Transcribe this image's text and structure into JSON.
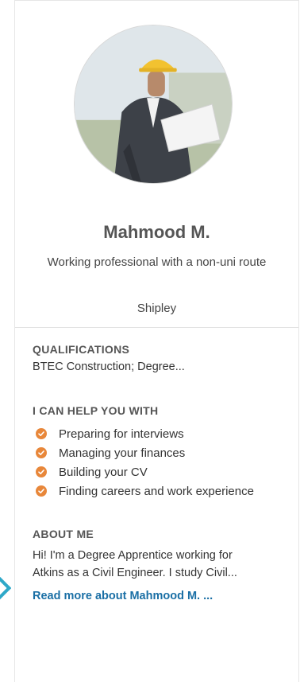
{
  "profile": {
    "name": "Mahmood M.",
    "tagline": "Working professional with a non-uni route",
    "location": "Shipley"
  },
  "qualifications": {
    "title": "QUALIFICATIONS",
    "text": "BTEC Construction; Degree..."
  },
  "help": {
    "title": "I CAN HELP YOU WITH",
    "items": [
      {
        "label": "Preparing for interviews",
        "icon": "check-icon"
      },
      {
        "label": "Managing your finances",
        "icon": "check-icon"
      },
      {
        "label": "Building your CV",
        "icon": "check-icon"
      },
      {
        "label": "Finding careers and work experience",
        "icon": "check-icon"
      }
    ]
  },
  "about": {
    "title": "ABOUT ME",
    "line1": "Hi! I'm a Degree Apprentice working for",
    "line2": "Atkins as a Civil Engineer. I study Civil..."
  },
  "read_more_label": "Read more about Mahmood M. ...",
  "colors": {
    "accent_orange": "#e8873a",
    "link_blue": "#1a6fa5",
    "left_accent": "#2ea8c8"
  }
}
